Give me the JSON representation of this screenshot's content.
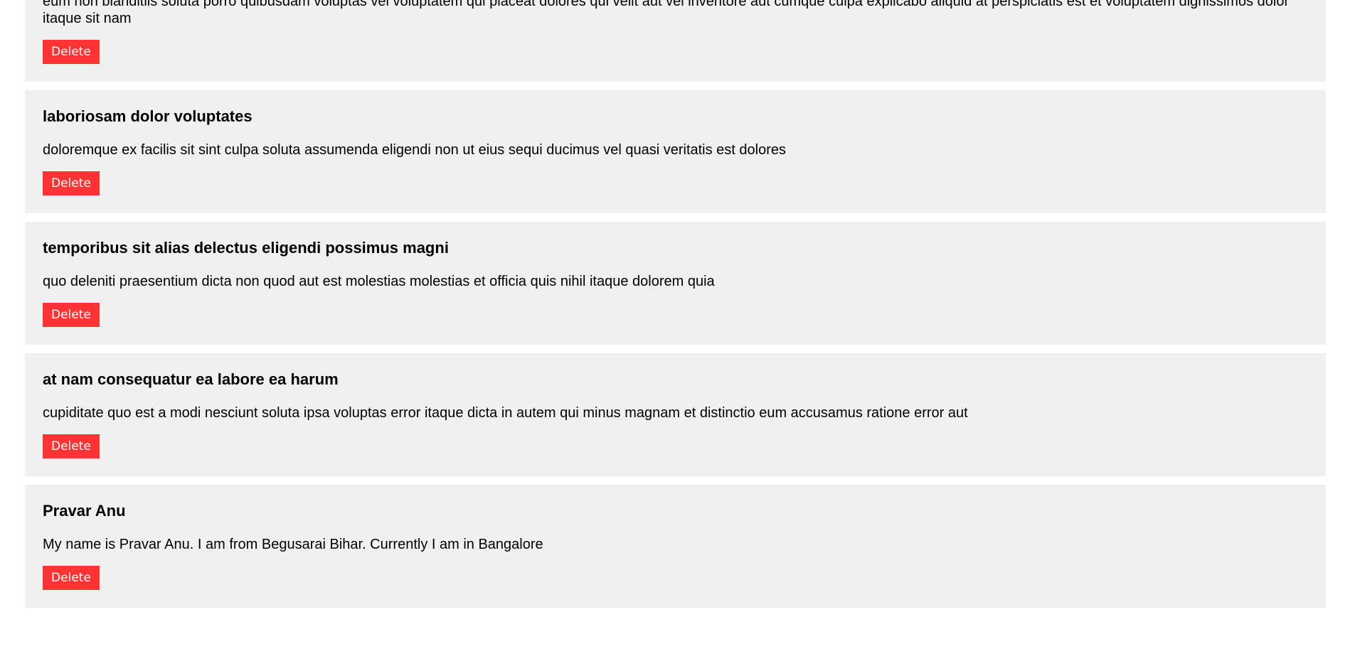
{
  "posts": [
    {
      "title": "",
      "body": "eum non blanditiis soluta porro quibusdam voluptas vel voluptatem qui placeat dolores qui velit aut vel inventore aut cumque culpa explicabo aliquid at perspiciatis est et voluptatem dignissimos dolor itaque sit nam",
      "delete_label": "Delete"
    },
    {
      "title": "laboriosam dolor voluptates",
      "body": "doloremque ex facilis sit sint culpa soluta assumenda eligendi non ut eius sequi ducimus vel quasi veritatis est dolores",
      "delete_label": "Delete"
    },
    {
      "title": "temporibus sit alias delectus eligendi possimus magni",
      "body": "quo deleniti praesentium dicta non quod aut est molestias molestias et officia quis nihil itaque dolorem quia",
      "delete_label": "Delete"
    },
    {
      "title": "at nam consequatur ea labore ea harum",
      "body": "cupiditate quo est a modi nesciunt soluta ipsa voluptas error itaque dicta in autem qui minus magnam et distinctio eum accusamus ratione error aut",
      "delete_label": "Delete"
    },
    {
      "title": "Pravar Anu",
      "body": "My name is Pravar Anu. I am from Begusarai Bihar. Currently I am in Bangalore",
      "delete_label": "Delete"
    }
  ],
  "colors": {
    "card_background": "#f0f0f0",
    "delete_button": "#ff3333",
    "delete_button_text": "#ffffff"
  }
}
